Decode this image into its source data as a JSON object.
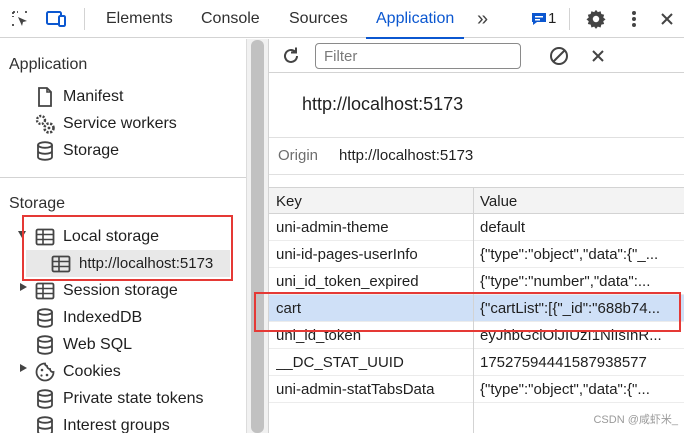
{
  "toolbar": {
    "tabs": [
      "Elements",
      "Console",
      "Sources",
      "Application"
    ],
    "active_tab": "Application",
    "more_tabs_glyph": "»",
    "issues_count": "1",
    "icons": [
      "inspect-icon",
      "device-toolbar-icon",
      "chevrons-right-icon",
      "issues-chat-icon",
      "settings-gear-icon",
      "more-vertical-icon"
    ]
  },
  "sidebar": {
    "application_title": "Application",
    "application_items": [
      "Manifest",
      "Service workers",
      "Storage"
    ],
    "storage_title": "Storage",
    "storage_items": {
      "local_storage": "Local storage",
      "local_storage_origin": "http://localhost:5173",
      "session_storage": "Session storage",
      "indexeddb": "IndexedDB",
      "websql": "Web SQL",
      "cookies": "Cookies",
      "private_state_tokens": "Private state tokens",
      "interest_groups": "Interest groups"
    }
  },
  "main": {
    "filter_placeholder": "Filter",
    "origin_heading": "http://localhost:5173",
    "origin_label": "Origin",
    "origin_value": "http://localhost:5173",
    "table": {
      "headers": [
        "Key",
        "Value"
      ],
      "rows": [
        {
          "key": "uni-admin-theme",
          "value": "default"
        },
        {
          "key": "uni-id-pages-userInfo",
          "value": "{\"type\":\"object\",\"data\":{\"_..."
        },
        {
          "key": "uni_id_token_expired",
          "value": "{\"type\":\"number\",\"data\":..."
        },
        {
          "key": "cart",
          "value": "{\"cartList\":[{\"_id\":\"688b74..."
        },
        {
          "key": "uni_id_token",
          "value": "eyJhbGciOiJIUzI1NiIsInR..."
        },
        {
          "key": "__DC_STAT_UUID",
          "value": "17527594441587938577"
        },
        {
          "key": "uni-admin-statTabsData",
          "value": "{\"type\":\"object\",\"data\":{\"..."
        }
      ],
      "selected_key": "cart"
    }
  },
  "watermark": "CSDN @咸虾米_",
  "colors": {
    "accent": "#0b57d0",
    "selected_row": "#cfe0f7",
    "annotation": "#e53935"
  }
}
